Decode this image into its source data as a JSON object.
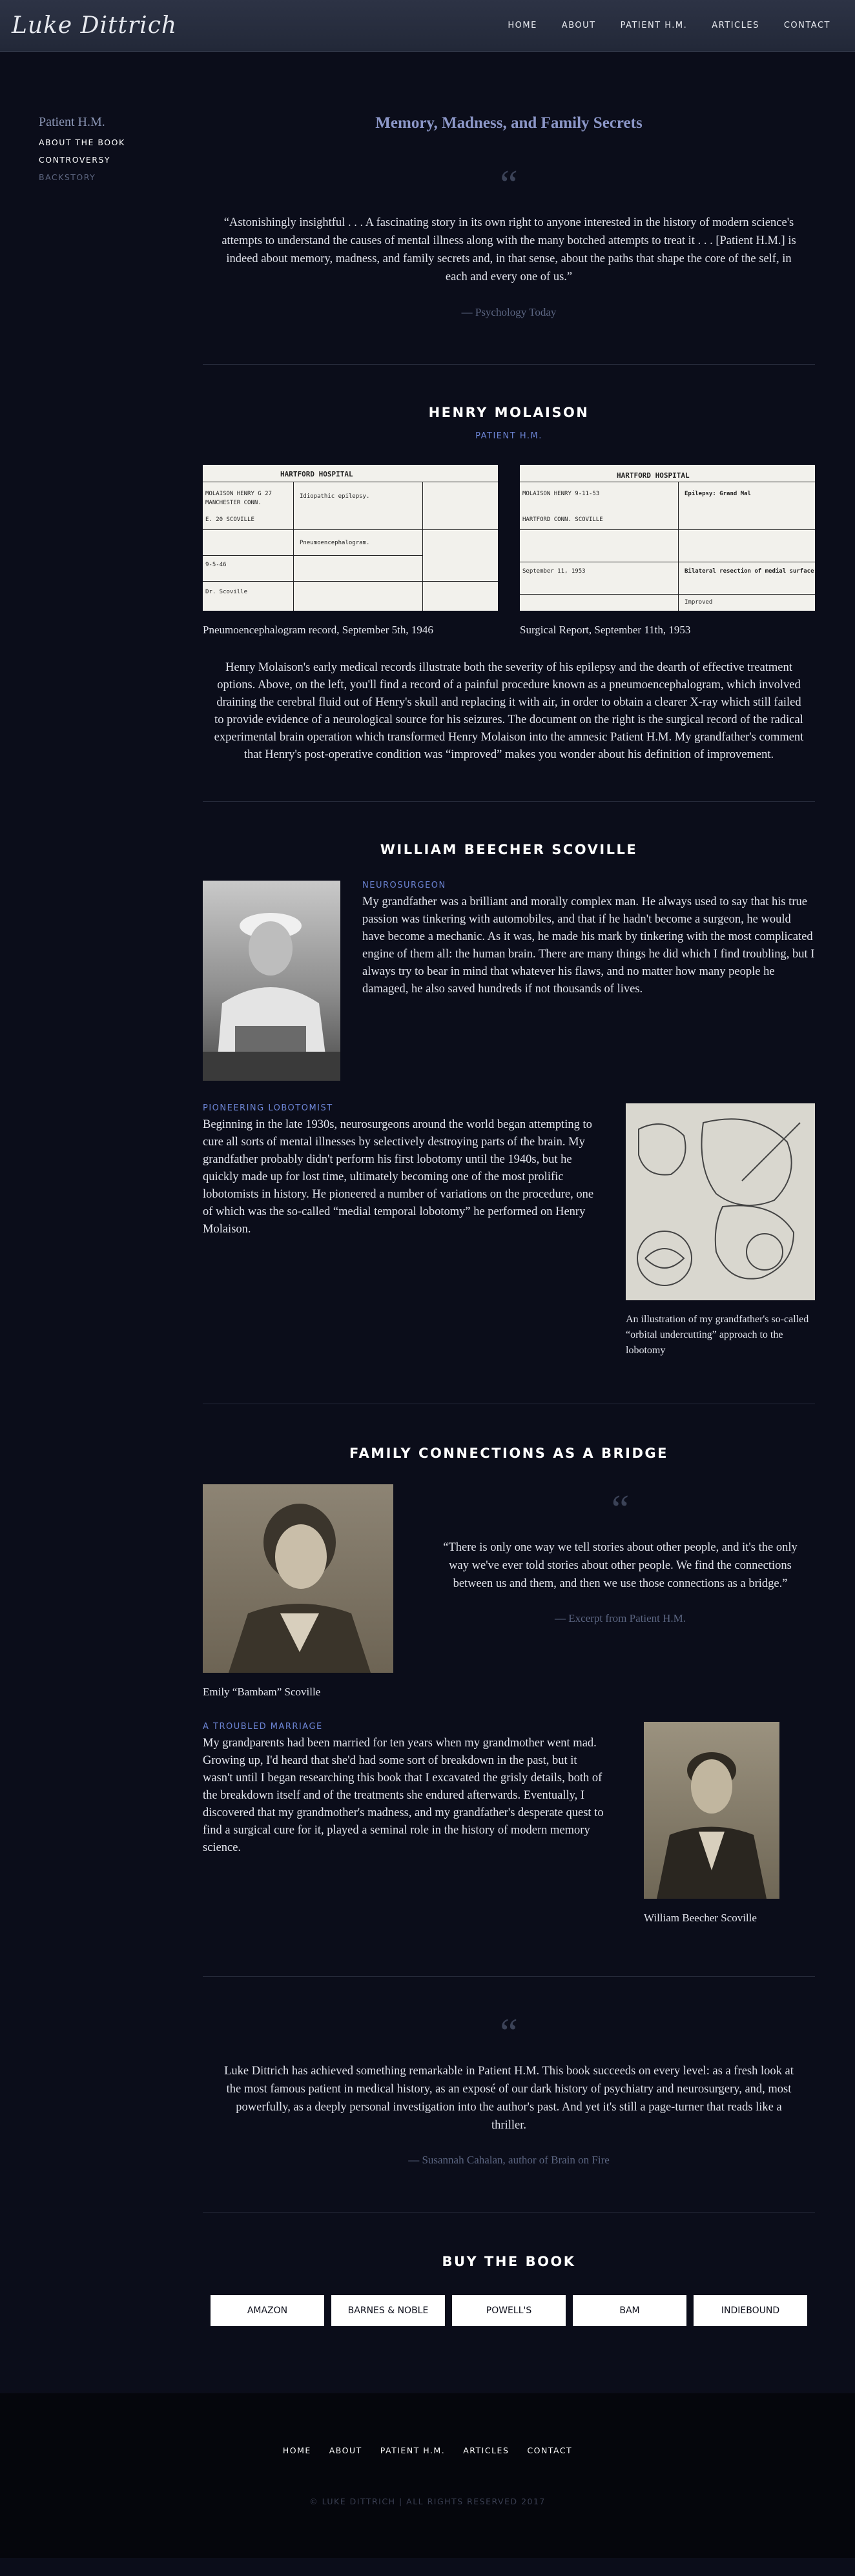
{
  "header": {
    "logo": "Luke Dittrich",
    "nav": [
      "HOME",
      "ABOUT",
      "PATIENT H.M.",
      "ARTICLES",
      "CONTACT"
    ]
  },
  "sidenav": {
    "parent": "Patient H.M.",
    "items": [
      {
        "label": "ABOUT THE BOOK",
        "active": true
      },
      {
        "label": "CONTROVERSY",
        "active": true
      },
      {
        "label": "BACKSTORY",
        "active": false
      }
    ]
  },
  "intro": {
    "title": "Memory, Madness, and Family Secrets",
    "quote_mark": "“",
    "quote": "“Astonishingly insightful . . . A fascinating story in its own right to anyone interested in the history of modern science's attempts to understand the causes of mental illness along with the many botched attempts to treat it . . . [Patient H.M.] is indeed about memory, madness, and family secrets and, in that sense, about the paths that shape the core of the self, in each and every one of us.”",
    "cite": "— Psychology Today"
  },
  "molaison": {
    "title": "HENRY MOLAISON",
    "subtitle": "PATIENT H.M.",
    "doc1": {
      "header": "HARTFORD HOSPITAL",
      "caption": "Pneumoencephalogram record, September 5th, 1946",
      "text_a": "Idiopathic epilepsy.",
      "text_b": "Pneumoencephalogram."
    },
    "doc2": {
      "header": "HARTFORD HOSPITAL",
      "caption": "Surgical Report, September 11th, 1953",
      "text_a": "Epilepsy: Grand Mal",
      "text_b": "Bilateral resection of medial surface,",
      "text_c": "Improved"
    },
    "body": "Henry Molaison's early medical records illustrate both the severity of his epilepsy and the dearth of effective treatment options. Above, on the left, you'll find a record of a painful procedure known as a pneumoencephalogram, which involved draining the cerebral fluid out of Henry's skull and replacing it with air, in order to obtain a clearer X-ray which still failed to provide evidence of a neurological source for his seizures. The document on the right is the surgical record of the radical experimental brain operation which transformed Henry Molaison into the amnesic Patient H.M. My grandfather's comment that Henry's post-operative condition was “improved” makes you wonder about his definition of improvement."
  },
  "scoville": {
    "title": "WILLIAM BEECHER SCOVILLE",
    "neurosurgeon_label": "NEUROSURGEON",
    "neurosurgeon_body": "My grandfather was a brilliant and morally complex man. He always used to say that his true passion was tinkering with automobiles, and that if he hadn't become a surgeon, he would have become a mechanic. As it was, he made his mark by tinkering with the most complicated engine of them all: the human brain. There are many things he did which I find troubling, but I always try to bear in mind that whatever his flaws, and no matter how many people he damaged, he also saved hundreds if not thousands of lives.",
    "lobotomy_label": "PIONEERING LOBOTOMIST",
    "lobotomy_body": "Beginning in the late 1930s, neurosurgeons around the world began attempting to cure all sorts of mental illnesses by selectively destroying parts of the brain. My grandfather probably didn't perform his first lobotomy until the 1940s, but he quickly made up for lost time, ultimately becoming one of the most prolific lobotomists in history. He pioneered a number of variations on the procedure, one of which was the so-called “medial temporal lobotomy” he performed on Henry Molaison.",
    "illustration_caption": "An illustration of my grandfather's so-called “orbital undercutting” approach to the lobotomy"
  },
  "family": {
    "title": "FAMILY CONNECTIONS AS A BRIDGE",
    "emily_caption": "Emily “Bambam” Scoville",
    "quote_mark": "“",
    "quote": "“There is only one way we tell stories about other people, and it's the only way we've ever told stories about other people. We find the connections between us and them, and then we use those connections as a bridge.”",
    "cite": "— Excerpt from Patient H.M.",
    "marriage_label": "A TROUBLED MARRIAGE",
    "marriage_body": "My grandparents had been married for ten years when my grandmother went mad. Growing up, I'd heard that she'd had some sort of breakdown in the past, but it wasn't until I began researching this book that I excavated the grisly details, both of the breakdown itself and of the treatments she endured afterwards. Eventually, I discovered that my grandmother's madness, and my grandfather's desperate quest to find a surgical cure for it, played a seminal role in the history of modern memory science.",
    "william_caption": "William Beecher Scoville"
  },
  "review": {
    "quote_mark": "“",
    "quote": "Luke Dittrich has achieved something remarkable in Patient H.M. This book succeeds on every level: as a fresh look at the most famous patient in medical history, as an exposé of our dark history of psychiatry and neurosurgery, and, most powerfully, as a deeply personal investigation into the author's past. And yet it's still a page-turner that reads like a thriller.",
    "cite": "— Susannah Cahalan, author of Brain on Fire"
  },
  "buy": {
    "title": "BUY THE BOOK",
    "buttons": [
      "AMAZON",
      "BARNES & NOBLE",
      "POWELL'S",
      "BAM",
      "INDIEBOUND"
    ]
  },
  "footer": {
    "nav": [
      "HOME",
      "ABOUT",
      "PATIENT H.M.",
      "ARTICLES",
      "CONTACT"
    ],
    "copyright": "© LUKE DITTRICH | ALL RIGHTS RESERVED 2017"
  }
}
